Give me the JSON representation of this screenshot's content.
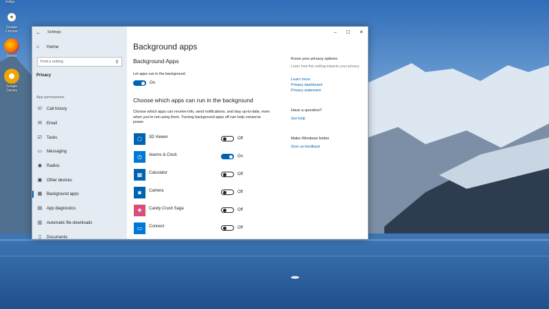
{
  "desktop": {
    "top_label": "Indigo",
    "icons": [
      {
        "name": "chrome-icon",
        "label": "Google Chrome"
      },
      {
        "name": "firefox-icon",
        "label": "Firefox"
      },
      {
        "name": "canary-icon",
        "label": "Google Canary"
      }
    ]
  },
  "window": {
    "title": "Settings",
    "back_glyph": "←",
    "controls": {
      "minimize": "–",
      "maximize": "☐",
      "close": "✕"
    }
  },
  "sidebar": {
    "home_label": "Home",
    "search_placeholder": "Find a setting",
    "section_label": "Privacy",
    "group_label": "App permissions",
    "items": [
      {
        "label": "Call history",
        "icon": "call-history-icon",
        "glyph": "☏"
      },
      {
        "label": "Email",
        "icon": "email-icon",
        "glyph": "✉"
      },
      {
        "label": "Tasks",
        "icon": "tasks-icon",
        "glyph": "☑"
      },
      {
        "label": "Messaging",
        "icon": "messaging-icon",
        "glyph": "▭"
      },
      {
        "label": "Radios",
        "icon": "radios-icon",
        "glyph": "◉"
      },
      {
        "label": "Other devices",
        "icon": "other-devices-icon",
        "glyph": "▣"
      },
      {
        "label": "Background apps",
        "icon": "background-apps-icon",
        "glyph": "▦",
        "active": true
      },
      {
        "label": "App diagnostics",
        "icon": "app-diagnostics-icon",
        "glyph": "▤"
      },
      {
        "label": "Automatic file downloads",
        "icon": "file-downloads-icon",
        "glyph": "▥"
      },
      {
        "label": "Documents",
        "icon": "documents-icon",
        "glyph": "▯"
      }
    ]
  },
  "main": {
    "page_title": "Background apps",
    "sub_title": "Background Apps",
    "master_toggle_label": "Let apps run in the background",
    "master_toggle_state": "On",
    "section_title": "Choose which apps can run in the background",
    "description": "Choose which apps can receive info, send notifications, and stay up-to-date, even when you're not using them. Turning background apps off can help conserve power.",
    "apps": [
      {
        "name": "3D Viewer",
        "icon": "3d-viewer-icon",
        "glyph": "⬡",
        "state": "Off",
        "on": false,
        "color": "#0063b1"
      },
      {
        "name": "Alarms & Clock",
        "icon": "alarms-clock-icon",
        "glyph": "◷",
        "state": "On",
        "on": true,
        "color": "#0078d7"
      },
      {
        "name": "Calculator",
        "icon": "calculator-icon",
        "glyph": "▦",
        "state": "Off",
        "on": false,
        "color": "#0063b1"
      },
      {
        "name": "Camera",
        "icon": "camera-icon",
        "glyph": "◙",
        "state": "Off",
        "on": false,
        "color": "#0063b1"
      },
      {
        "name": "Candy Crush Saga",
        "icon": "candy-crush-icon",
        "glyph": "❖",
        "state": "Off",
        "on": false,
        "color": "#d94f7b"
      },
      {
        "name": "Connect",
        "icon": "connect-icon",
        "glyph": "▭",
        "state": "Off",
        "on": false,
        "color": "#0078d7"
      }
    ]
  },
  "related": {
    "privacy_head": "Know your privacy options",
    "privacy_text": "Learn how this setting impacts your privacy.",
    "links": [
      "Learn more",
      "Privacy dashboard",
      "Privacy statement"
    ],
    "question_head": "Have a question?",
    "help_link": "Get help",
    "better_head": "Make Windows better",
    "feedback_link": "Give us feedback"
  },
  "colors": {
    "accent": "#0063b1"
  }
}
